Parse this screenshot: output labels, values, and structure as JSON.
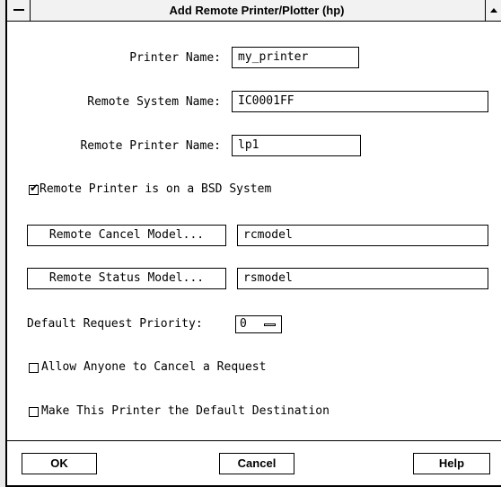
{
  "window": {
    "title": "Add Remote Printer/Plotter (hp)"
  },
  "form": {
    "printer_name_label": "Printer Name:",
    "printer_name_value": "my_printer",
    "remote_system_label": "Remote System Name:",
    "remote_system_value": "IC0001FF",
    "remote_printer_label": "Remote Printer Name:",
    "remote_printer_value": "lp1",
    "bsd_label": "Remote Printer is on a BSD System",
    "bsd_checked": true,
    "cancel_model_button": "Remote Cancel Model...",
    "cancel_model_value": "rcmodel",
    "status_model_button": "Remote Status Model...",
    "status_model_value": "rsmodel",
    "priority_label": "Default Request Priority:",
    "priority_value": "0",
    "allow_cancel_label": "Allow Anyone to Cancel a Request",
    "allow_cancel_checked": false,
    "default_dest_label": "Make This Printer the Default Destination",
    "default_dest_checked": false
  },
  "footer": {
    "ok_label": "OK",
    "cancel_label": "Cancel",
    "help_label": "Help"
  }
}
